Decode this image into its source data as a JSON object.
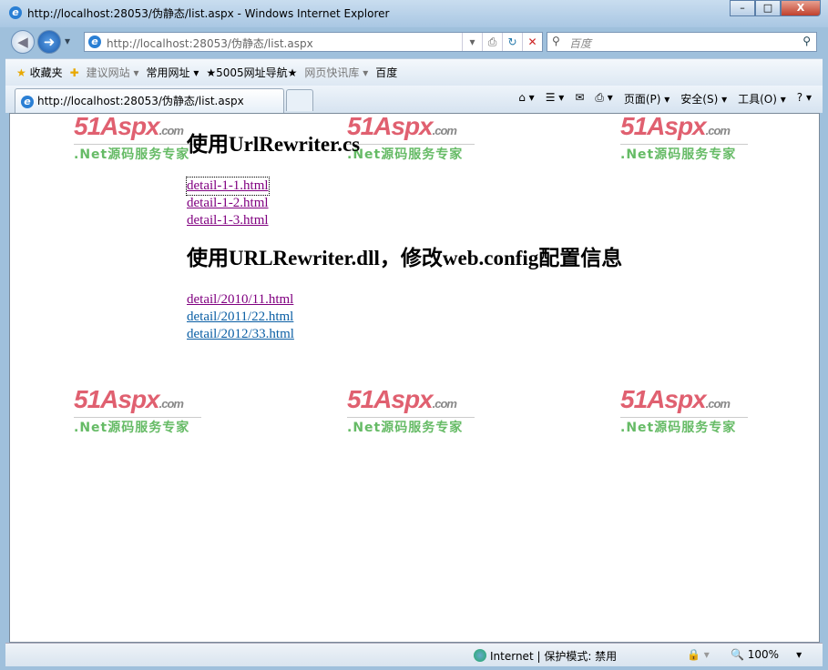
{
  "window": {
    "title": "http://localhost:28053/伪静态/list.aspx - Windows Internet Explorer",
    "min": "–",
    "max": "□",
    "close": "X"
  },
  "nav": {
    "back": "◀",
    "forward": "➜",
    "dropdown": "▾",
    "address": "http://localhost:28053/伪静态/list.aspx",
    "compat": "⎙",
    "refresh": "↻",
    "stop": "✕",
    "search_placeholder": "百度",
    "search_icon": "⚲"
  },
  "favorites": {
    "label": "收藏夹",
    "items": [
      "建议网站 ▾",
      "常用网址 ▾",
      "★5005网址导航★",
      "网页快讯库 ▾",
      "百度"
    ]
  },
  "tab": {
    "title": "http://localhost:28053/伪静态/list.aspx"
  },
  "commands": [
    "⌂ ▾",
    "☰ ▾",
    "✉",
    "⎙ ▾",
    "页面(P) ▾",
    "安全(S) ▾",
    "工具(O) ▾",
    "? ▾"
  ],
  "watermark": {
    "logo": "51Aspx",
    "domain": ".com",
    "slogan": ".Net源码服务专家"
  },
  "page": {
    "heading1": "使用UrlRewriter.cs",
    "links1": [
      "detail-1-1.html",
      "detail-1-2.html",
      "detail-1-3.html"
    ],
    "heading2": "使用URLRewriter.dll，修改web.config配置信息",
    "links2": [
      "detail/2010/11.html",
      "detail/2011/22.html",
      "detail/2012/33.html"
    ]
  },
  "status": {
    "zone": "Internet | 保护模式: 禁用",
    "zoom": "100%"
  }
}
